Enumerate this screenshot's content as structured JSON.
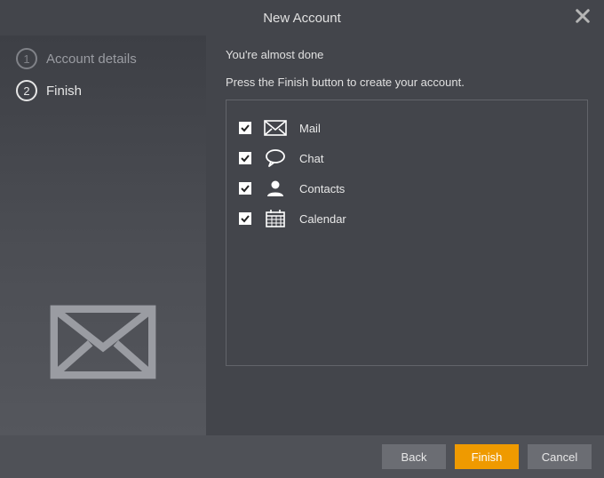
{
  "title": "New Account",
  "sidebar": {
    "steps": [
      {
        "num": "1",
        "label": "Account details",
        "active": false
      },
      {
        "num": "2",
        "label": "Finish",
        "active": true
      }
    ]
  },
  "main": {
    "heading": "You're almost done",
    "subheading": "Press the Finish button to create your account.",
    "options": [
      {
        "key": "mail",
        "label": "Mail",
        "checked": true
      },
      {
        "key": "chat",
        "label": "Chat",
        "checked": true
      },
      {
        "key": "contacts",
        "label": "Contacts",
        "checked": true
      },
      {
        "key": "calendar",
        "label": "Calendar",
        "checked": true
      }
    ]
  },
  "footer": {
    "back": "Back",
    "finish": "Finish",
    "cancel": "Cancel"
  }
}
